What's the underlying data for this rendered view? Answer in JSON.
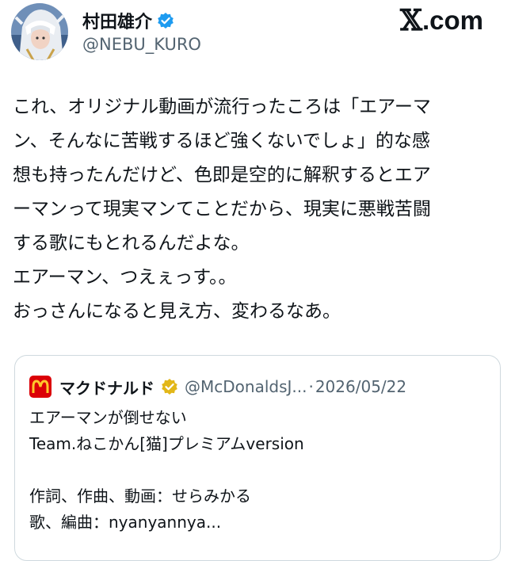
{
  "author": {
    "display_name": "村田雄介",
    "handle": "@NEBU_KURO",
    "avatar_icon": "avatar-icon",
    "verified_icon": "verified-badge-icon",
    "verified_color": "#1d9bf0"
  },
  "site": {
    "logo_text": ".com",
    "logo_glyph": "𝕏"
  },
  "tweet": {
    "lines": [
      "これ、オリジナル動画が流行ったころは「エアーマ",
      "ン、そんなに苦戦するほど強くないでしょ」的な感",
      "想も持ったんだけど、色即是空的に解釈するとエア",
      "ーマンって現実マンてことだから、現実に悪戦苦闘",
      "する歌にもとれるんだよな。",
      "エアーマン、つえぇっす。。",
      "おっさんになると見え方、変わるなあ。"
    ]
  },
  "quote": {
    "account_name": "マクドナルド",
    "handle": "@McDonaldsJ...",
    "separator": "·",
    "date": "2026/05/22",
    "logo_icon": "mcdonalds-logo-icon",
    "logo_color": "#db0007",
    "logo_arch_color": "#ffc72c",
    "badge_icon": "gold-verified-badge-icon",
    "badge_color": "#e2b719",
    "lines": [
      "エアーマンが倒せない",
      "Team.ねこかん[猫]プレミアムversion",
      "",
      "作詞、作曲、動画：せらみかる",
      "歌、編曲：nyanyannya..."
    ]
  }
}
